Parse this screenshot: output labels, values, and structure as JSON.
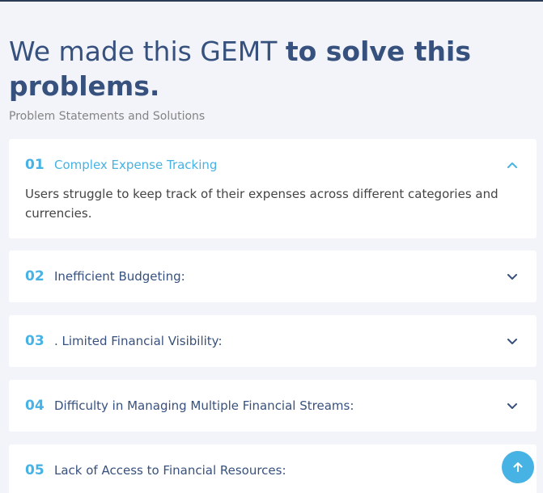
{
  "section": {
    "heading_light": "We made this GEMT ",
    "heading_strong": "to solve this problems.",
    "subheading": "Problem Statements and Solutions"
  },
  "faq": [
    {
      "number": "01",
      "title": "Complex Expense Tracking",
      "body": "Users struggle to keep track of their expenses across different categories and currencies.",
      "expanded": true,
      "icon": "chevron-up-icon"
    },
    {
      "number": "02",
      "title": "Inefficient Budgeting:",
      "expanded": false,
      "icon": "chevron-down-icon"
    },
    {
      "number": "03",
      "title": ". Limited Financial Visibility:",
      "expanded": false,
      "icon": "chevron-down-icon"
    },
    {
      "number": "04",
      "title": "Difficulty in Managing Multiple Financial Streams:",
      "expanded": false,
      "icon": "chevron-down-icon"
    },
    {
      "number": "05",
      "title": "Lack of Access to Financial Resources:",
      "expanded": false,
      "icon": "chevron-down-icon"
    }
  ],
  "back_to_top": {
    "icon": "arrow-up-icon"
  },
  "colors": {
    "accent": "#47b2e4",
    "heading": "#37517e",
    "background": "#f3f4f9",
    "card": "#ffffff"
  }
}
